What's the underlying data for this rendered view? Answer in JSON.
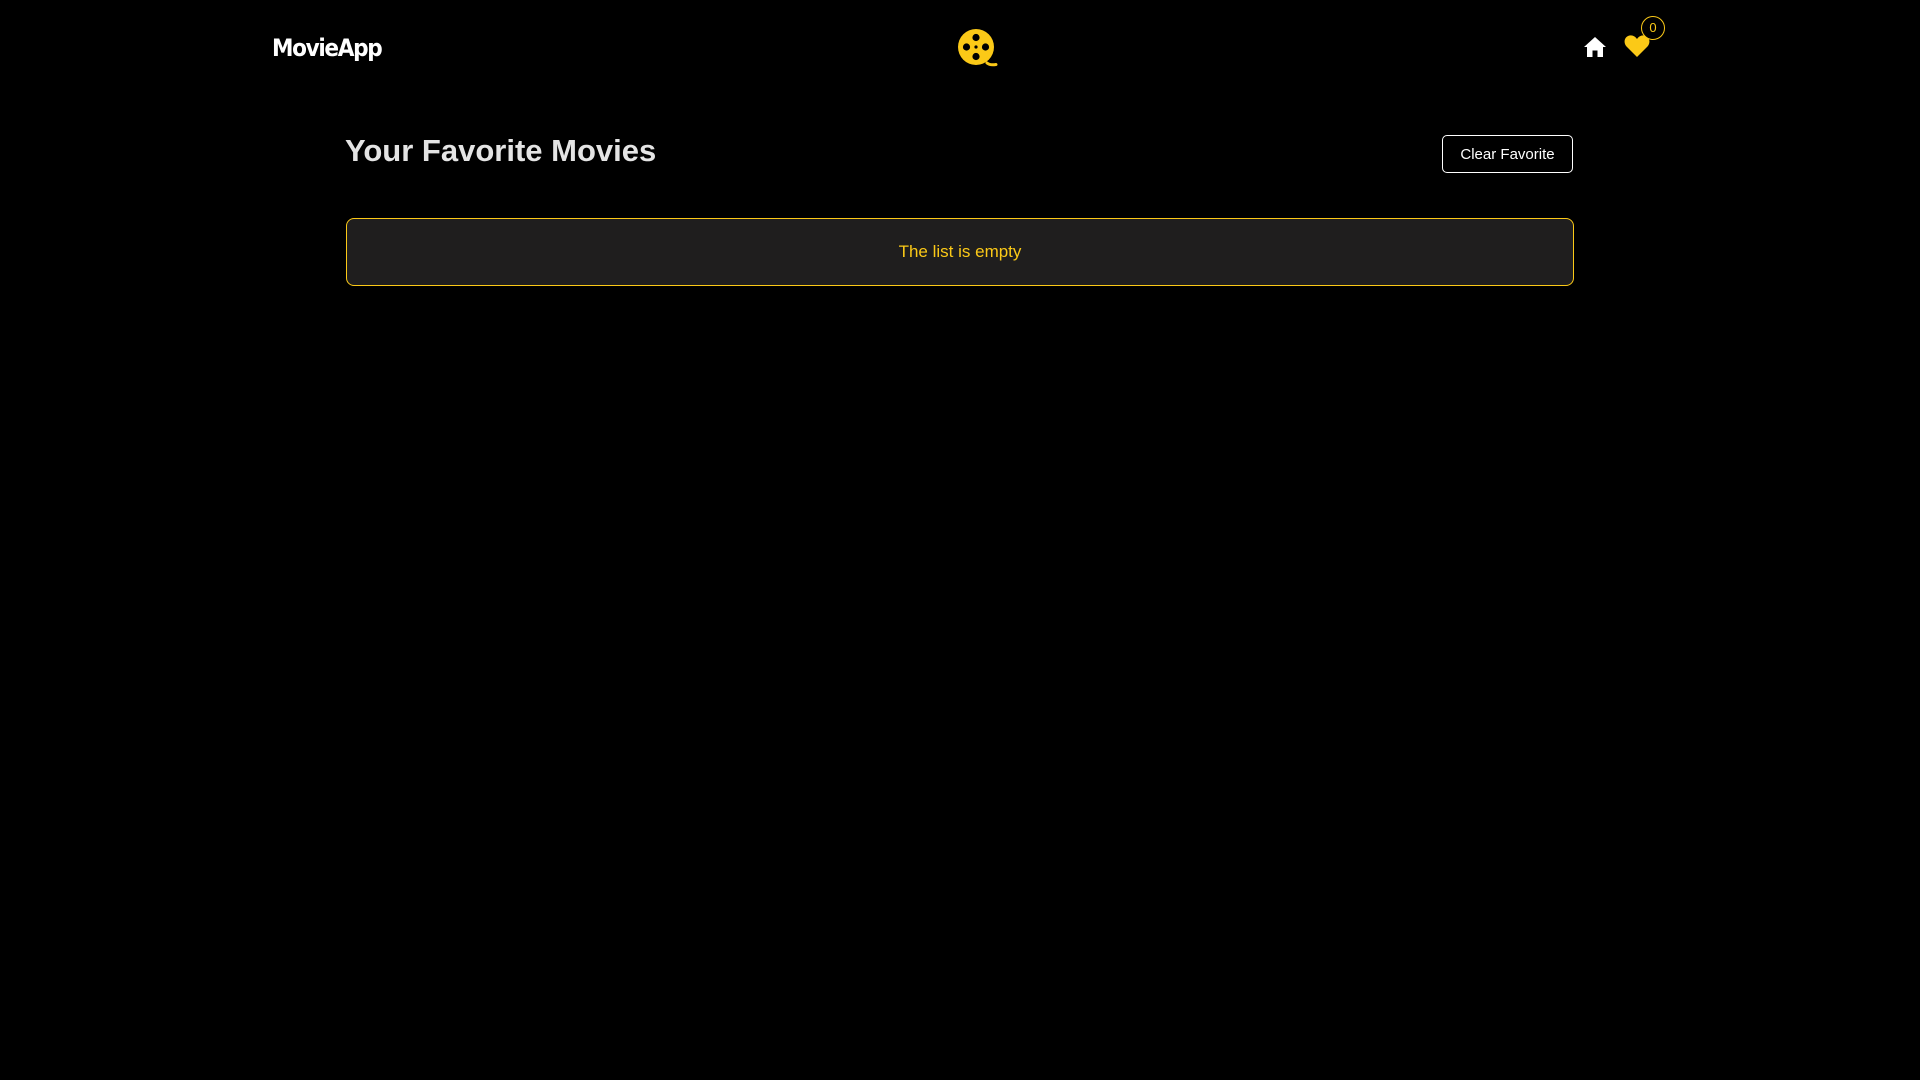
{
  "navbar": {
    "brand": "MovieApp",
    "logo_icon": "film-reel-icon",
    "home_icon": "home-icon",
    "favorites_icon": "heart-icon",
    "favorites_count": "0"
  },
  "main": {
    "title": "Your Favorite Movies",
    "clear_button_label": "Clear Favorite",
    "empty_message": "The list is empty"
  },
  "colors": {
    "background": "#000000",
    "accent": "#fbc917",
    "panel": "#1f1e1e",
    "text": "#ffffff",
    "heading": "#e4e4e4"
  }
}
